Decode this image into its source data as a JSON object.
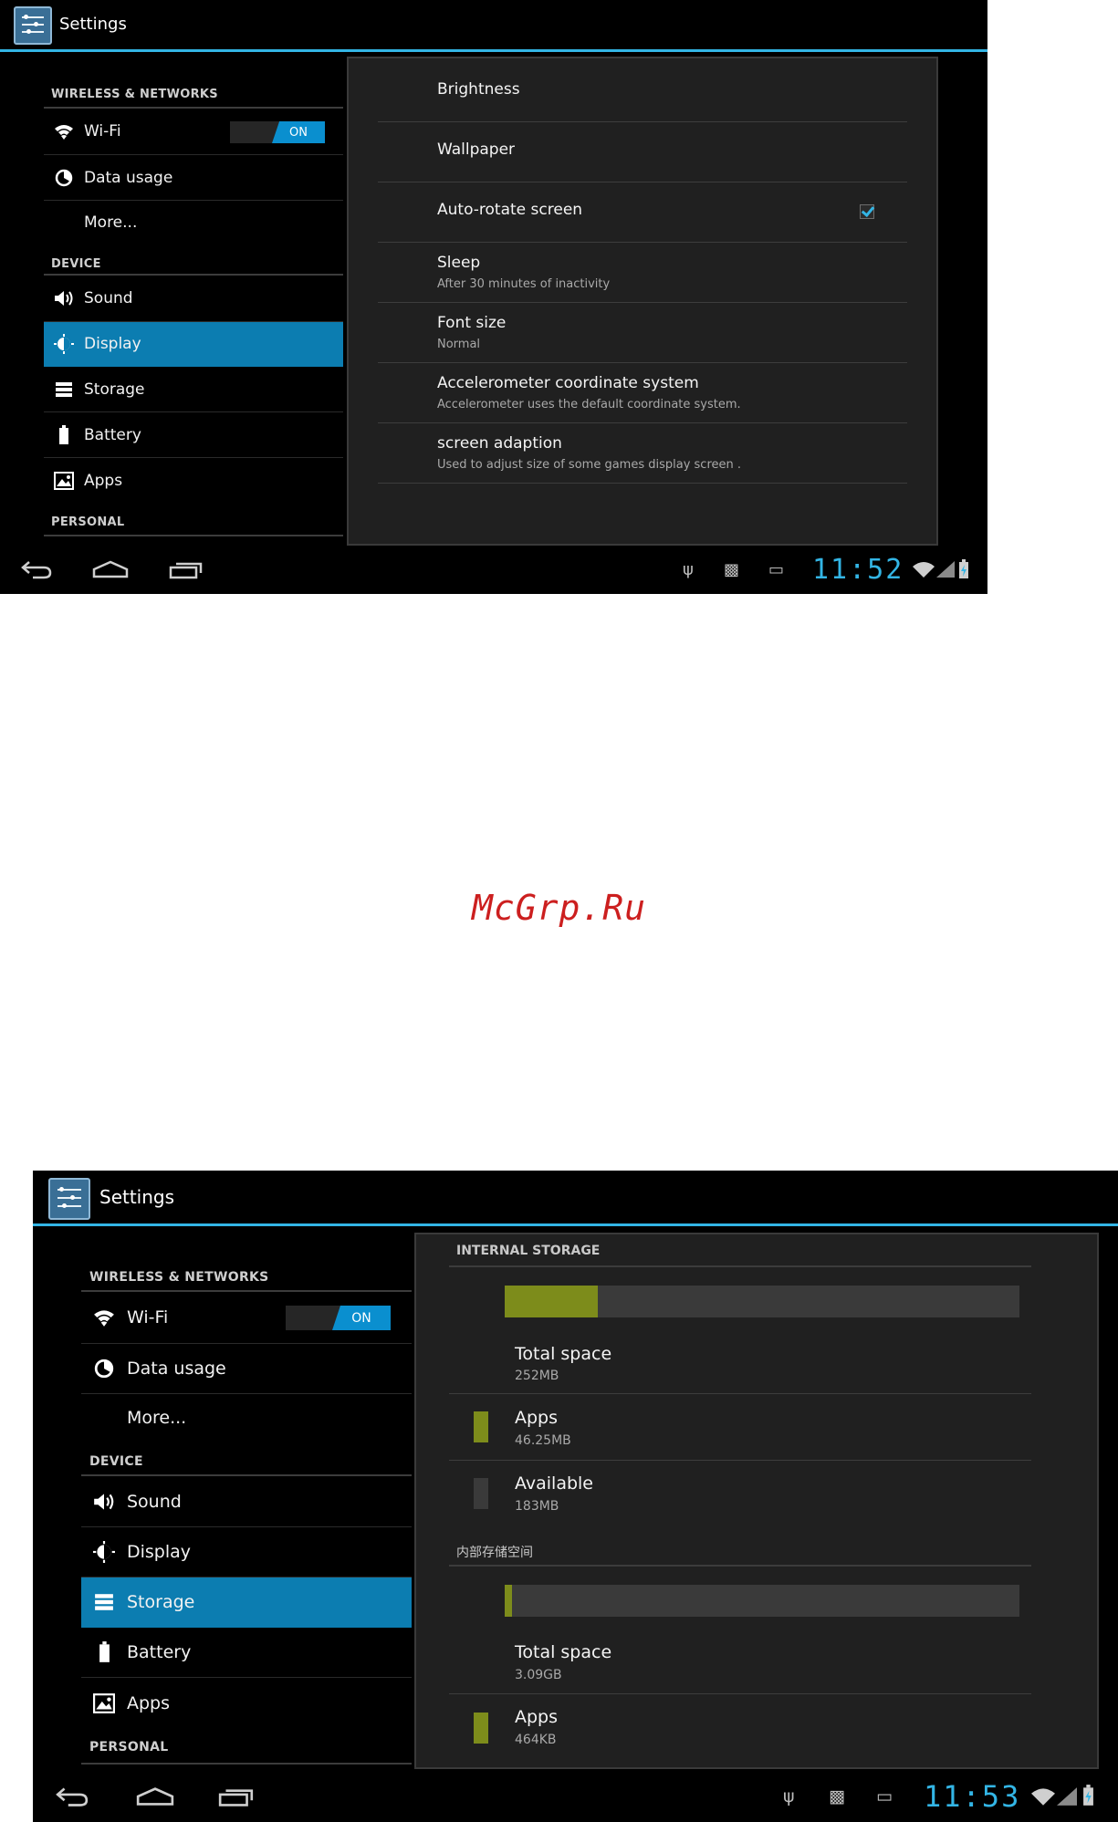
{
  "screen1": {
    "title": "Settings",
    "sections": {
      "wireless": "WIRELESS & NETWORKS",
      "device": "DEVICE",
      "personal": "PERSONAL"
    },
    "nav": {
      "wifi": "Wi-Fi",
      "wifi_toggle": "ON",
      "data_usage": "Data usage",
      "more": "More...",
      "sound": "Sound",
      "display": "Display",
      "storage": "Storage",
      "battery": "Battery",
      "apps": "Apps"
    },
    "selected": "Display",
    "display_settings": [
      {
        "title": "Brightness",
        "summary": ""
      },
      {
        "title": "Wallpaper",
        "summary": ""
      },
      {
        "title": "Auto-rotate screen",
        "summary": "",
        "checked": true
      },
      {
        "title": "Sleep",
        "summary": "After 30 minutes of inactivity"
      },
      {
        "title": "Font size",
        "summary": "Normal"
      },
      {
        "title": "Accelerometer coordinate system",
        "summary": "Accelerometer uses the default coordinate system."
      },
      {
        "title": "screen adaption",
        "summary": "Used to adjust size of some games display screen ."
      }
    ],
    "clock": "11:52"
  },
  "screen2": {
    "title": "Settings",
    "sections": {
      "wireless": "WIRELESS & NETWORKS",
      "device": "DEVICE",
      "personal": "PERSONAL"
    },
    "nav": {
      "wifi": "Wi-Fi",
      "wifi_toggle": "ON",
      "data_usage": "Data usage",
      "more": "More...",
      "sound": "Sound",
      "display": "Display",
      "storage": "Storage",
      "battery": "Battery",
      "apps": "Apps"
    },
    "selected": "Storage",
    "internal_storage": {
      "header": "INTERNAL STORAGE",
      "usage_fraction": 0.18,
      "total_label": "Total space",
      "total_value": "252MB",
      "apps_label": "Apps",
      "apps_value": "46.25MB",
      "available_label": "Available",
      "available_value": "183MB"
    },
    "internal_sd": {
      "header": "内部存储空间",
      "usage_fraction": 0.015,
      "total_label": "Total space",
      "total_value": "3.09GB",
      "apps_label": "Apps",
      "apps_value": "464KB"
    },
    "colors": {
      "apps": "#7d8c1b",
      "available": "#3a3a3a",
      "accent": "#33b5e5",
      "selected": "#0c7db1"
    },
    "clock": "11:53"
  },
  "watermark": "McGrp.Ru"
}
